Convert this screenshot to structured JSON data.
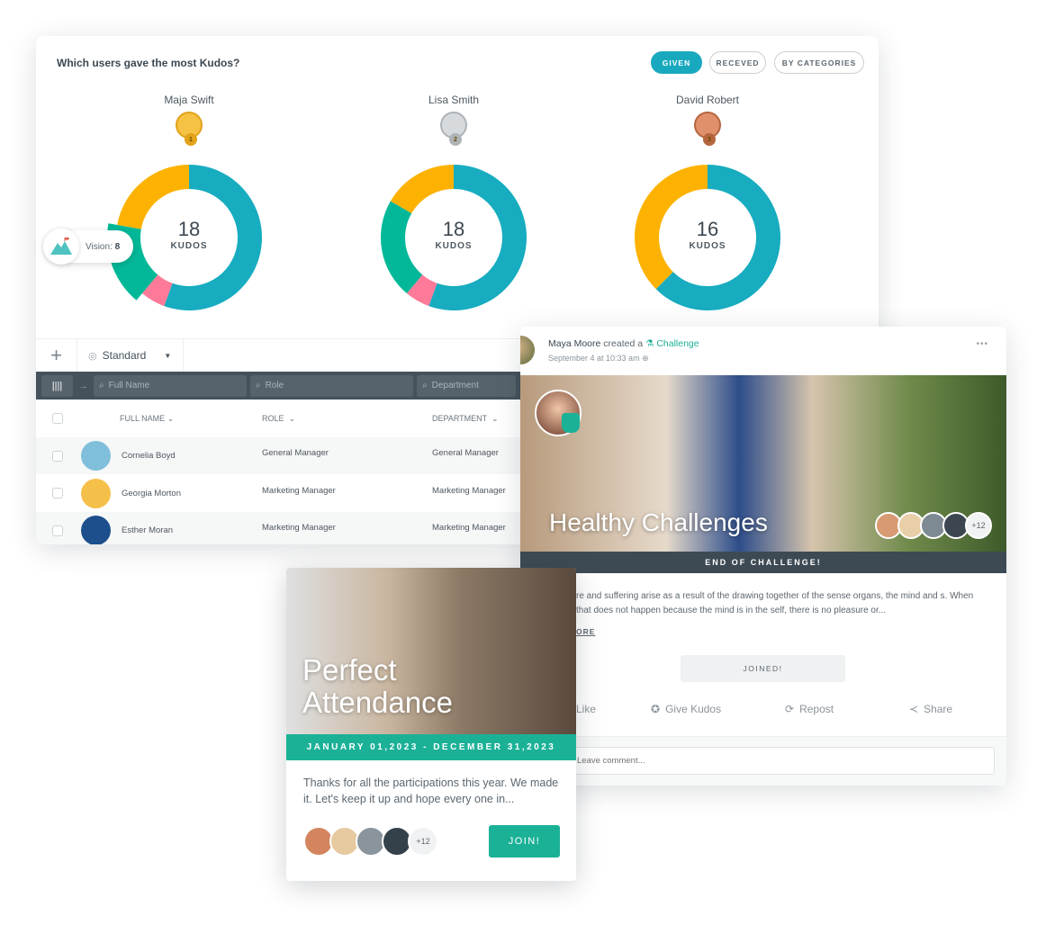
{
  "kudos": {
    "title": "Which users gave the most Kudos?",
    "filters": [
      {
        "label": "GIVEN",
        "active": true
      },
      {
        "label": "RECEVED",
        "active": false
      },
      {
        "label": "BY CATEGORIES",
        "active": false
      }
    ],
    "colors": {
      "teal": "#17acc0",
      "yellow": "#fdb201",
      "green": "#03b898",
      "pink": "#ff7a99"
    },
    "users": [
      {
        "name": "Maja Swift",
        "rank": "1",
        "total": "18",
        "unit": "KUDOS",
        "segments": [
          {
            "color": "teal",
            "value": 10
          },
          {
            "color": "pink",
            "value": 1
          },
          {
            "color": "green",
            "value": 3
          },
          {
            "color": "yellow",
            "value": 4
          }
        ]
      },
      {
        "name": "Lisa Smith",
        "rank": "2",
        "total": "18",
        "unit": "KUDOS",
        "segments": [
          {
            "color": "teal",
            "value": 10
          },
          {
            "color": "pink",
            "value": 1
          },
          {
            "color": "green",
            "value": 4
          },
          {
            "color": "yellow",
            "value": 3
          }
        ]
      },
      {
        "name": "David Robert",
        "rank": "3",
        "total": "16",
        "unit": "KUDOS",
        "segments": [
          {
            "color": "teal",
            "value": 10
          },
          {
            "color": "yellow",
            "value": 6
          }
        ]
      }
    ],
    "tooltip": {
      "label": "Vision:",
      "value": "8"
    }
  },
  "table": {
    "view": "Standard",
    "filters": {
      "name": "Full Name",
      "role": "Role",
      "department": "Department"
    },
    "columns": [
      "FULL NAME",
      "ROLE",
      "DEPARTMENT"
    ],
    "rows": [
      {
        "name": "Cornelia Boyd",
        "role": "General Manager",
        "department": "General Manager"
      },
      {
        "name": "Georgia Morton",
        "role": "Marketing Manager",
        "department": "Marketing Manager"
      },
      {
        "name": "Esther Moran",
        "role": "Marketing Manager",
        "department": "Marketing Manager"
      }
    ]
  },
  "post": {
    "author": "Maya Moore",
    "action": "created a",
    "type": "Challenge",
    "date": "September 4 at 10:33 am",
    "title": "Healthy Challenges",
    "more_count": "+12",
    "status": "END OF CHALLENGE!",
    "text": "re and suffering arise as a result of the drawing together of the sense organs, the mind and s. When that does not happen because the mind is in the self, there is no pleasure or...",
    "read_more": "ORE",
    "joined_label": "JOINED!",
    "actions": {
      "like": "Like",
      "kudos": "Give Kudos",
      "repost": "Repost",
      "share": "Share"
    },
    "comment_placeholder": "Leave comment..."
  },
  "attendance": {
    "title_line1": "Perfect",
    "title_line2": "Attendance",
    "dates": "JANUARY 01,2023 - DECEMBER 31,2023",
    "text": "Thanks for all the participations this year. We made it. Let's keep it up and hope every one in...",
    "more_count": "+12",
    "join_label": "JOIN!"
  }
}
